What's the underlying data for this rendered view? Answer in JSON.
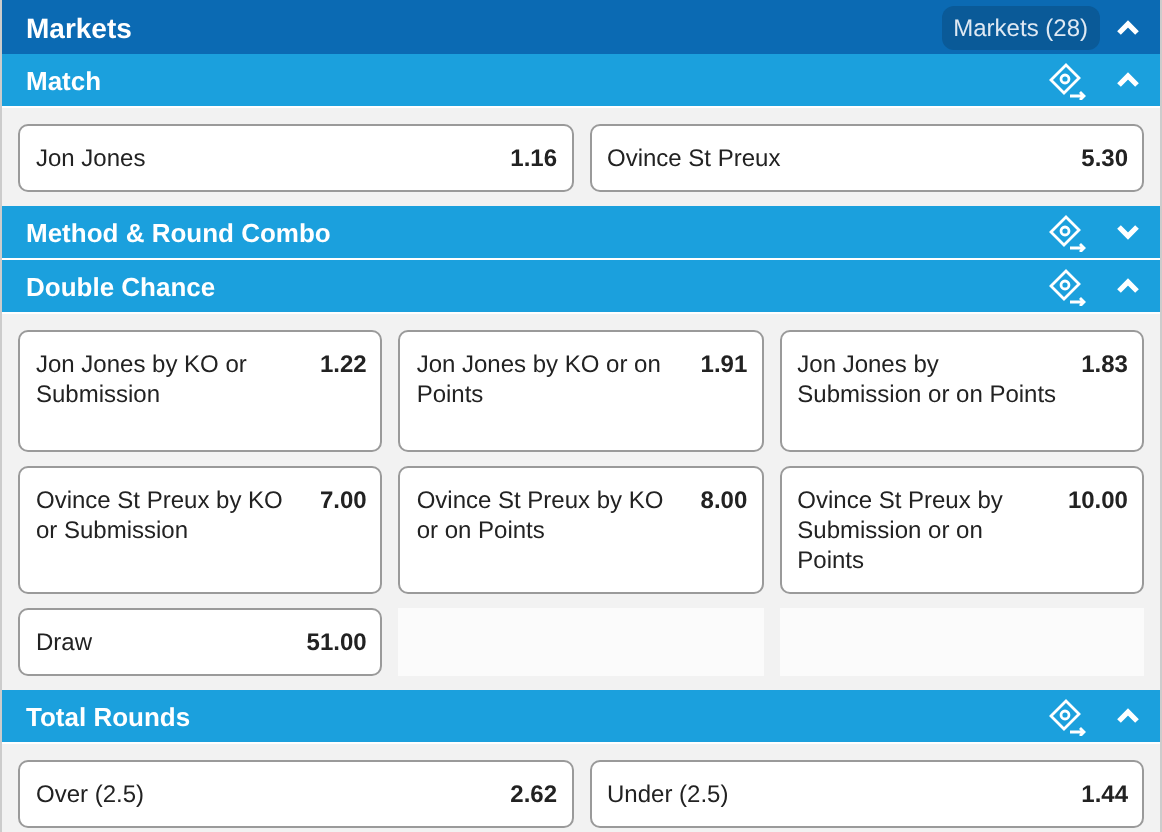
{
  "header": {
    "title": "Markets",
    "badge": "Markets (28)",
    "expanded": true
  },
  "sections": [
    {
      "title": "Match",
      "expanded": true,
      "kind": "pair",
      "selections": [
        {
          "name": "Jon Jones",
          "odds": "1.16"
        },
        {
          "name": "Ovince St Preux",
          "odds": "5.30"
        }
      ]
    },
    {
      "title": "Method & Round Combo",
      "expanded": false
    },
    {
      "title": "Double Chance",
      "expanded": true,
      "kind": "grid",
      "selections": [
        {
          "name": "Jon Jones by KO or Submission",
          "odds": "1.22"
        },
        {
          "name": "Jon Jones by KO or on Points",
          "odds": "1.91"
        },
        {
          "name": "Jon Jones by Submission or on Points",
          "odds": "1.83"
        },
        {
          "name": "Ovince St Preux by KO or Submission",
          "odds": "7.00"
        },
        {
          "name": "Ovince St Preux by KO or on Points",
          "odds": "8.00"
        },
        {
          "name": "Ovince St Preux by Submission or on Points",
          "odds": "10.00"
        },
        {
          "name": "Draw",
          "odds": "51.00"
        }
      ]
    },
    {
      "title": "Total Rounds",
      "expanded": true,
      "kind": "pair",
      "selections": [
        {
          "name": "Over (2.5)",
          "odds": "2.62"
        },
        {
          "name": "Under (2.5)",
          "odds": "1.44"
        }
      ]
    }
  ]
}
